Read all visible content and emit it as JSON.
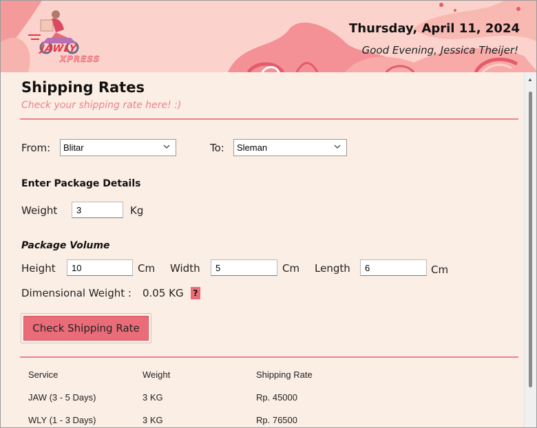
{
  "header": {
    "date": "Thursday, April 11, 2024",
    "greeting": "Good Evening, Jessica Theijer!",
    "logo_main": "JAWLY",
    "logo_sub": "XPRESS"
  },
  "page": {
    "title": "Shipping Rates",
    "subtitle": "Check your shipping rate here! :)"
  },
  "route": {
    "from_label": "From:",
    "from_value": "Blitar",
    "to_label": "To:",
    "to_value": "Sleman"
  },
  "package": {
    "section_title": "Enter Package Details",
    "weight_label": "Weight",
    "weight_value": "3",
    "weight_unit": "Kg",
    "volume_title": "Package Volume",
    "height_label": "Height",
    "height_value": "10",
    "width_label": "Width",
    "width_value": "5",
    "length_label": "Length",
    "length_value": "6",
    "unit_cm": "Cm",
    "dim_weight_label": "Dimensional Weight :",
    "dim_weight_value": "0.05 KG",
    "help": "?"
  },
  "action": {
    "check_label": "Check Shipping Rate"
  },
  "results": {
    "headers": [
      "Service",
      "Weight",
      "Shipping Rate"
    ],
    "rows": [
      [
        "JAW (3 - 5 Days)",
        "3 KG",
        "Rp. 45000"
      ],
      [
        "WLY (1 - 3 Days)",
        "3 KG",
        "Rp. 76500"
      ]
    ]
  },
  "colors": {
    "accent": "#e96c78",
    "banner": "#fcd3cc",
    "background": "#fbeee4"
  }
}
